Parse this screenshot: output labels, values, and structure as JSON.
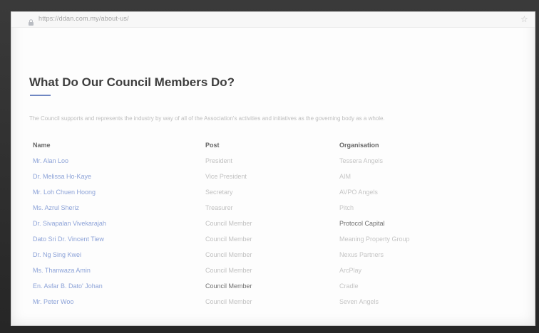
{
  "browser": {
    "url": "https://ddan.com.my/about-us/"
  },
  "page": {
    "title": "What Do Our Council Members Do?",
    "intro": "The Council supports and represents the industry by way of all of the Association's activities and initiatives as the governing body as a whole.",
    "table": {
      "headers": {
        "name": "Name",
        "post": "Post",
        "organisation": "Organisation"
      },
      "rows": [
        {
          "name": "Mr. Alan Loo",
          "post": "President",
          "organisation": "Tessera Angels"
        },
        {
          "name": "Dr. Melissa Ho-Kaye",
          "post": "Vice President",
          "organisation": "AIM"
        },
        {
          "name": "Mr. Loh Chuen Hoong",
          "post": "Secretary",
          "organisation": "AVPO Angels"
        },
        {
          "name": "Ms. Azrul Sheriz",
          "post": "Treasurer",
          "organisation": "Pitch"
        },
        {
          "name": "Dr. Sivapalan Vivekarajah",
          "post": "Council Member",
          "organisation": "Protocol Capital"
        },
        {
          "name": "Dato Sri Dr. Vincent Tiew",
          "post": "Council Member",
          "organisation": "Meaning Property Group"
        },
        {
          "name": "Dr. Ng Sing Kwei",
          "post": "Council Member",
          "organisation": "Nexus Partners"
        },
        {
          "name": "Ms. Thanwaza Amin",
          "post": "Council Member",
          "organisation": "ArcPlay"
        },
        {
          "name": "En. Asfar B. Dato' Johan",
          "post": "Council Member",
          "organisation": "Cradle"
        },
        {
          "name": "Mr. Peter Woo",
          "post": "Council Member",
          "organisation": "Seven Angels"
        }
      ]
    }
  }
}
